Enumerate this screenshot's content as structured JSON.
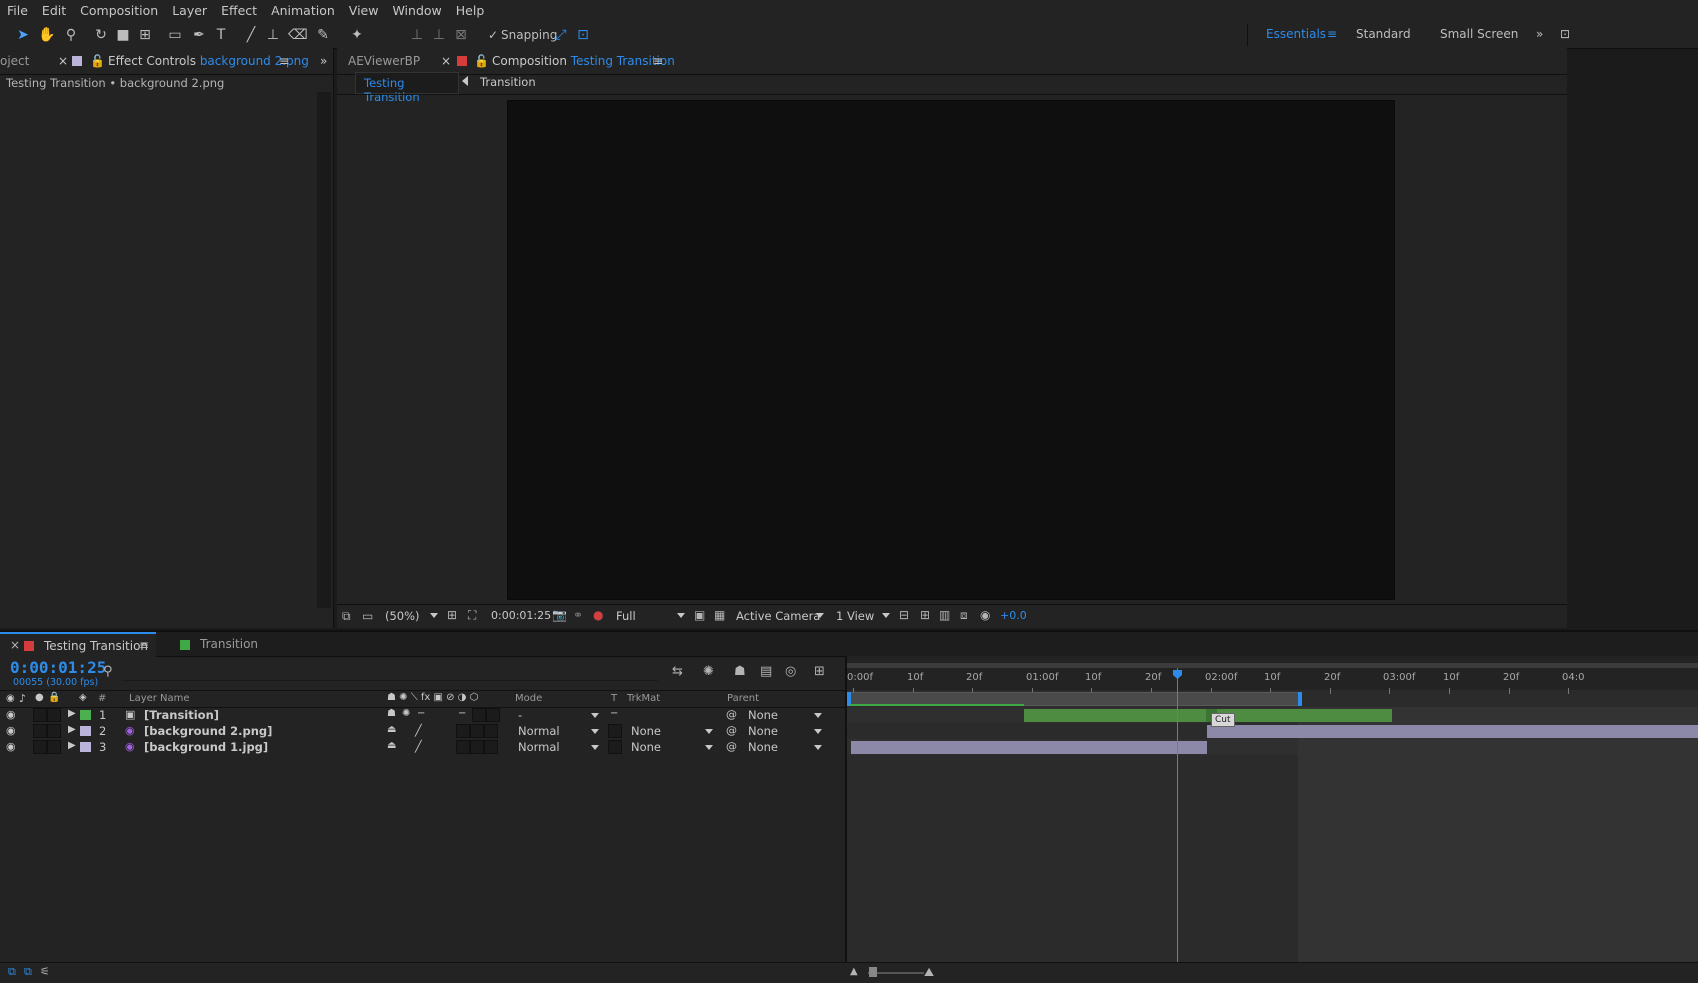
{
  "menu": [
    "File",
    "Edit",
    "Composition",
    "Layer",
    "Effect",
    "Animation",
    "View",
    "Window",
    "Help"
  ],
  "toolbar": {
    "snapping_label": "Snapping",
    "workspaces": [
      "Essentials",
      "Standard",
      "Small Screen"
    ],
    "active_workspace": "Essentials"
  },
  "left_panel": {
    "cut_tab": "oject",
    "tab_prefix": "Effect Controls",
    "tab_target": "background 2.png",
    "breadcrumb": "Testing Transition • background 2.png"
  },
  "viewer": {
    "tab_aeviewer": "AEViewerBP",
    "tab_prefix": "Composition",
    "tab_target": "Testing Transition",
    "subtab_active": "Testing Transition",
    "subtab_other": "Transition",
    "footer": {
      "zoom": "(50%)",
      "timecode": "0:00:01:25",
      "resolution": "Full",
      "camera": "Active Camera",
      "views": "1 View",
      "exposure": "+0.0"
    }
  },
  "timeline": {
    "tab_active": "Testing Transition",
    "tab_other": "Transition",
    "timecode": "0:00:01:25",
    "frame_info": "00055 (30.00 fps)",
    "columns": {
      "num": "#",
      "layer_name": "Layer Name",
      "mode": "Mode",
      "t": "T",
      "trkmat": "TrkMat",
      "parent": "Parent"
    },
    "layers": [
      {
        "num": "1",
        "name": "[Transition]",
        "mode": "-",
        "trkmat": "",
        "parent": "None",
        "color": "#4caf50"
      },
      {
        "num": "2",
        "name": "[background 2.png]",
        "mode": "Normal",
        "trkmat": "None",
        "parent": "None",
        "color": "#b9b4d8"
      },
      {
        "num": "3",
        "name": "[background 1.jpg]",
        "mode": "Normal",
        "trkmat": "None",
        "parent": "None",
        "color": "#b9b4d8"
      }
    ],
    "ruler_labels": [
      "0:00f",
      "10f",
      "20f",
      "01:00f",
      "10f",
      "20f",
      "02:00f",
      "10f",
      "20f",
      "03:00f",
      "10f",
      "20f",
      "04:0"
    ],
    "cut_marker": "Cut"
  },
  "colors": {
    "accent": "#2d8ceb",
    "transition_bar": "#4e8c42",
    "bg_bar": "#8c88a8",
    "panel": "#232323"
  }
}
